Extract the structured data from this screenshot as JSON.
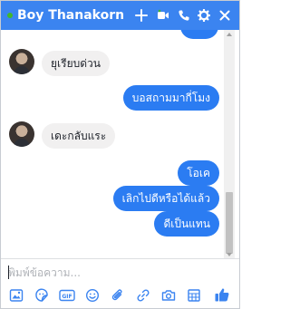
{
  "header": {
    "title": "Boy Thanakorn",
    "background_color": "#3b84f0",
    "online_dot_color": "#42b72a",
    "icons": [
      "add-icon",
      "video-call-icon",
      "phone-icon",
      "gear-icon",
      "close-icon"
    ]
  },
  "messages": [
    {
      "direction": "in",
      "text": "ยุเรียบด่วน"
    },
    {
      "direction": "out",
      "text": "บอสถามมากี่โมง"
    },
    {
      "direction": "in",
      "text": "เดะกลับแระ"
    },
    {
      "direction": "out",
      "text": "โอเค"
    },
    {
      "direction": "out",
      "text": "เลิกไปดีหรือได้แล้ว"
    },
    {
      "direction": "out",
      "text": "ดีเป็นแทน"
    }
  ],
  "composer": {
    "placeholder": "พิมพ์ข้อความ...",
    "value": ""
  },
  "toolbar": {
    "icons": [
      "image-icon",
      "sticker-icon",
      "gif-icon",
      "emoji-icon",
      "attachment-icon",
      "link-icon",
      "camera-icon",
      "table-icon",
      "like-icon"
    ],
    "gif_label": "GIF",
    "accent_color": "#3b84f0"
  },
  "colors": {
    "outgoing_bubble": "#2b7cf2",
    "incoming_bubble": "#f1f0f0"
  }
}
